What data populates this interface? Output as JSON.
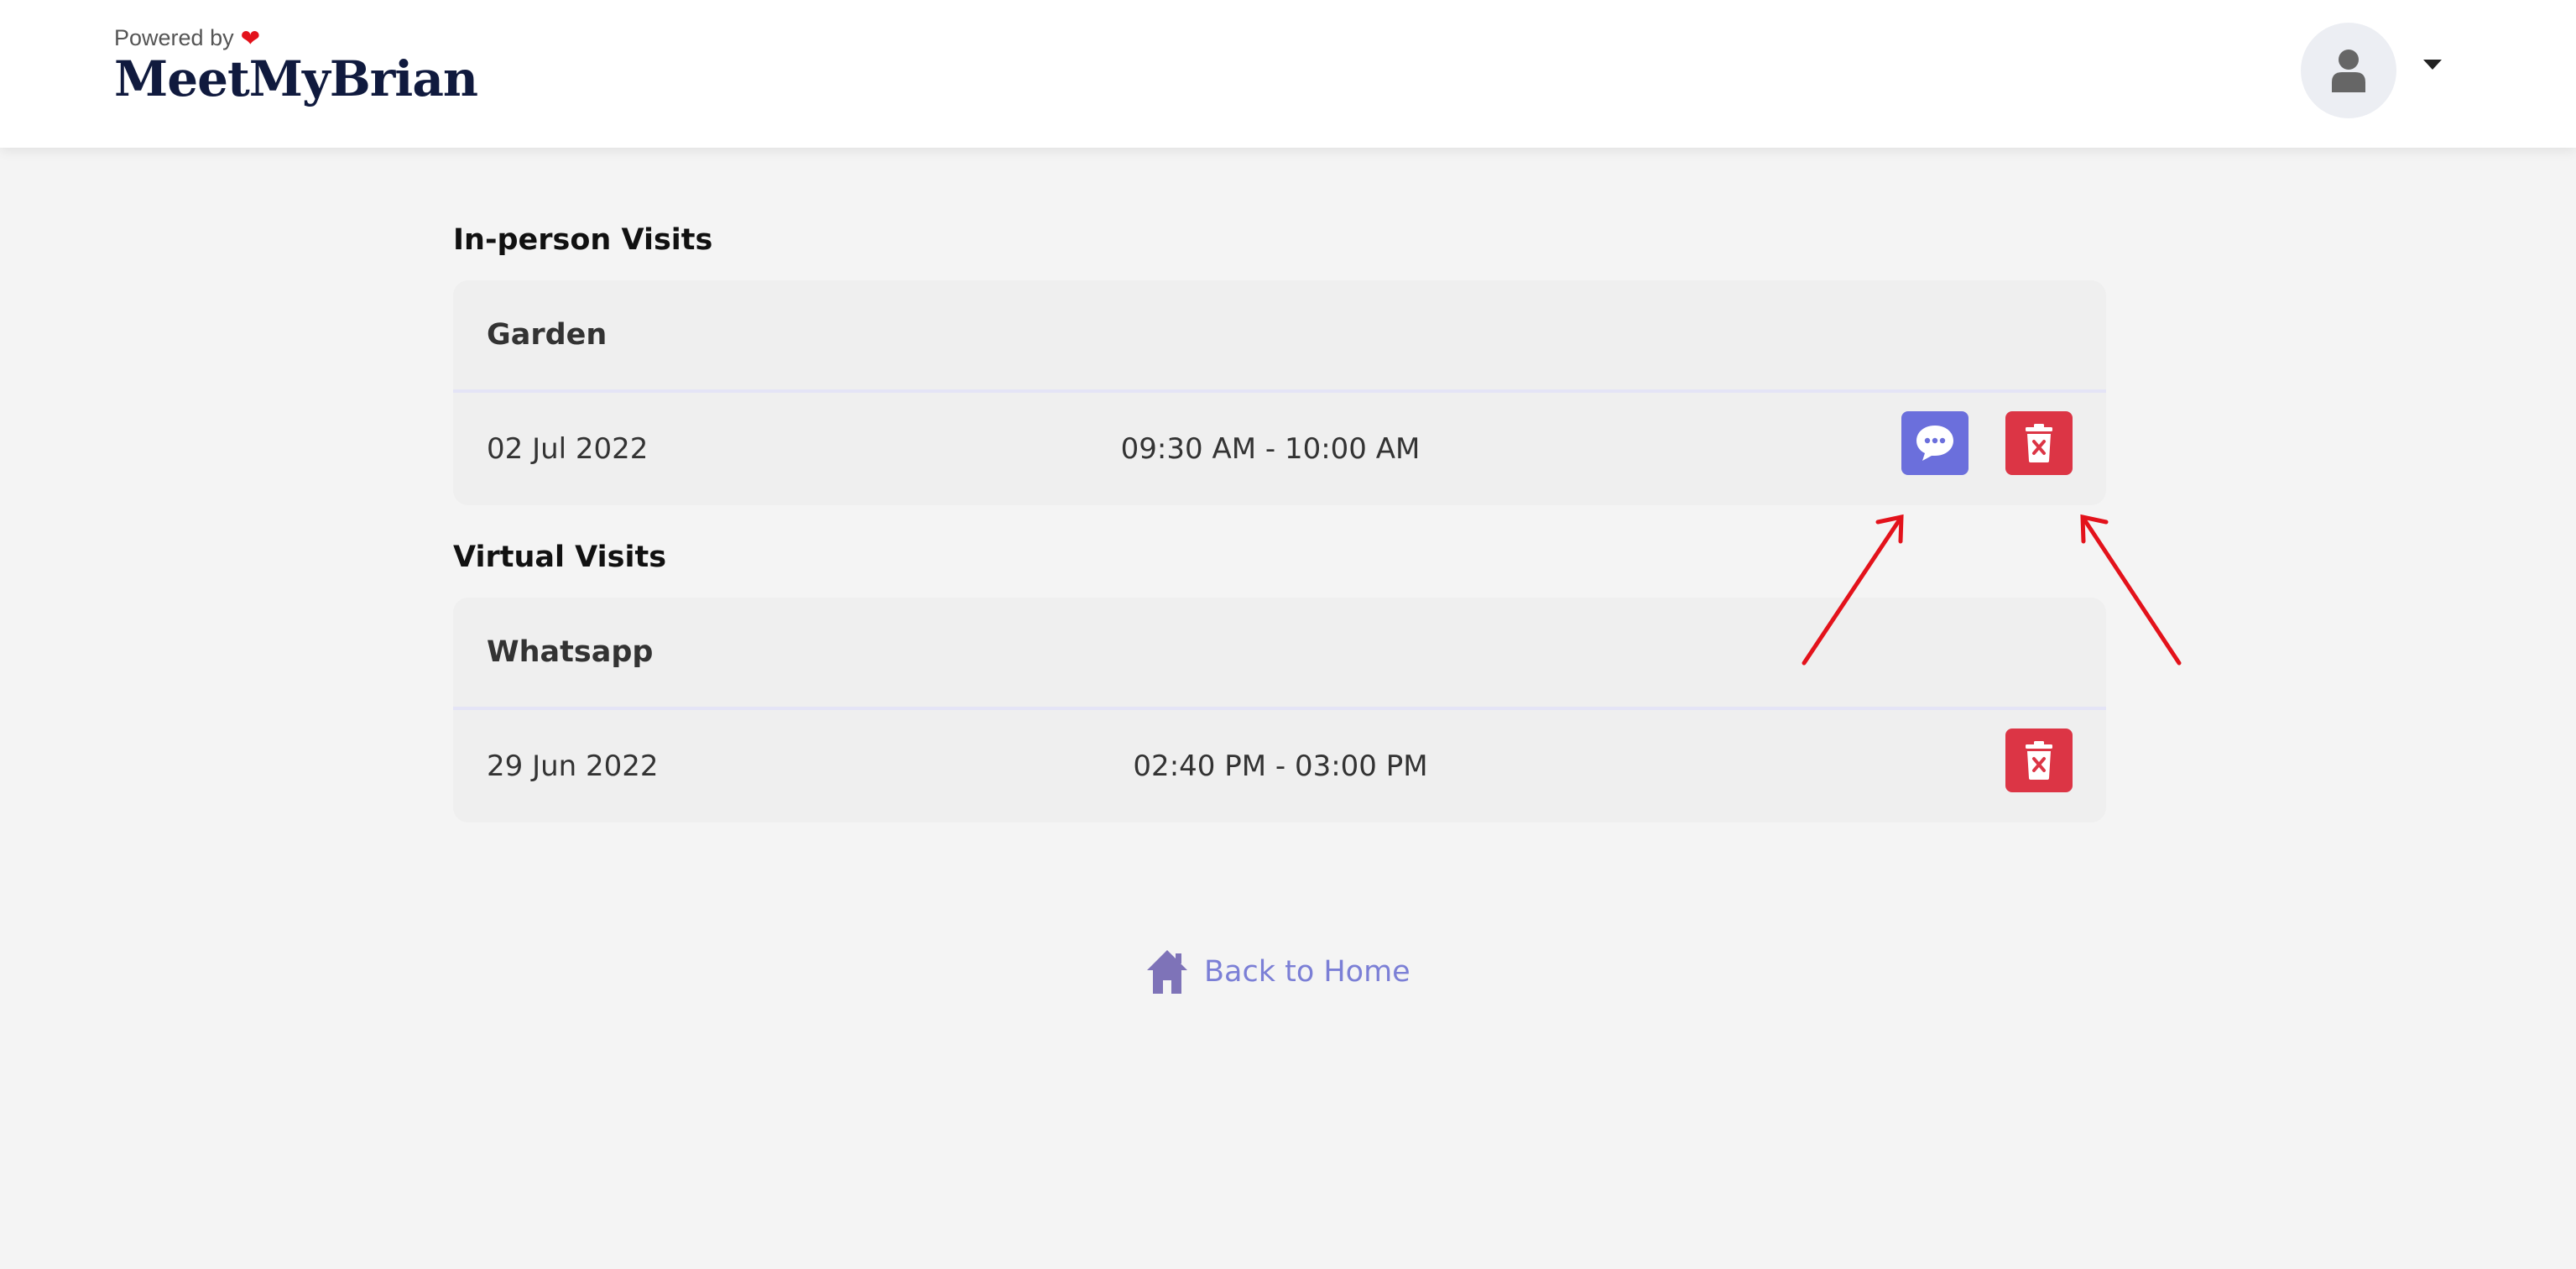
{
  "header": {
    "powered_by": "Powered by",
    "brand_name": "MeetMyBrian"
  },
  "sections": [
    {
      "title": "In-person Visits",
      "card": {
        "title": "Garden",
        "date": "02 Jul 2022",
        "time": "09:30 AM - 10:00 AM",
        "actions": [
          "chat-icon",
          "trash-icon"
        ]
      }
    },
    {
      "title": "Virtual Visits",
      "card": {
        "title": "Whatsapp",
        "date": "29 Jun 2022",
        "time": "02:40 PM - 03:00 PM",
        "actions": [
          "trash-icon"
        ]
      }
    }
  ],
  "footer": {
    "back_label": "Back to Home",
    "back_icon": "home-icon"
  },
  "colors": {
    "chat_button": "#6b6fdc",
    "delete_button": "#dc3545",
    "link": "#7b7fd6",
    "annotation_arrows": "#e3121b"
  }
}
